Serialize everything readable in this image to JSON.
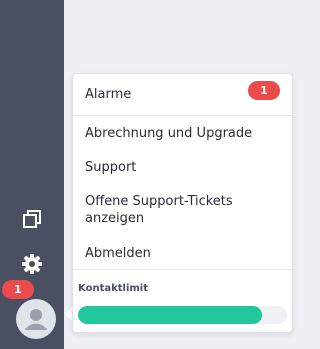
{
  "colors": {
    "sidebar_bg": "#4a4f62",
    "badge": "#ec4b4b",
    "progress_fill": "#21c79a",
    "progress_track": "#eef1f6"
  },
  "sidebar": {
    "items": [
      {
        "icon": "windows-icon"
      },
      {
        "icon": "gear-icon"
      }
    ],
    "avatar": {
      "icon": "user-avatar-icon",
      "badge_count": "1"
    }
  },
  "menu": {
    "alarme": {
      "label": "Alarme",
      "badge_count": "1"
    },
    "billing_label": "Abrechnung und Upgrade",
    "support_label": "Support",
    "tickets_label": "Offene Support-Tickets anzeigen",
    "logout_label": "Abmelden",
    "contact_limit": {
      "label": "Kontaktlimit",
      "fraction_used": 0.88
    }
  }
}
